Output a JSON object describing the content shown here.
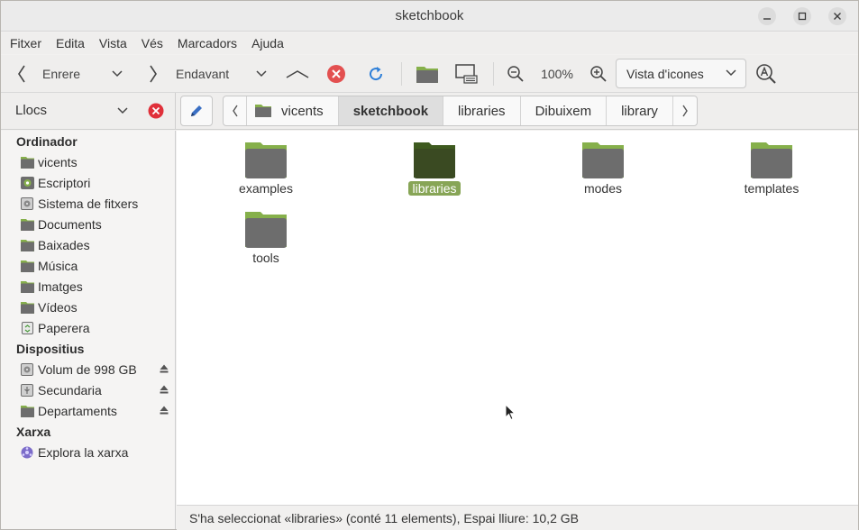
{
  "window": {
    "title": "sketchbook"
  },
  "menubar": [
    "Fitxer",
    "Edita",
    "Vista",
    "Vés",
    "Marcadors",
    "Ajuda"
  ],
  "toolbar": {
    "back_label": "Enrere",
    "forward_label": "Endavant",
    "zoom_level": "100%",
    "view_mode": "Vista d'icones"
  },
  "sidebar": {
    "header": "Llocs",
    "sections": [
      {
        "title": "Ordinador"
      },
      {
        "title": "Dispositius"
      },
      {
        "title": "Xarxa"
      }
    ],
    "items": [
      {
        "label": "vicents",
        "icon": "home-folder-icon"
      },
      {
        "label": "Escriptori",
        "icon": "desktop-icon"
      },
      {
        "label": "Sistema de fitxers",
        "icon": "drive-icon"
      },
      {
        "label": "Documents",
        "icon": "folder-icon"
      },
      {
        "label": "Baixades",
        "icon": "folder-icon"
      },
      {
        "label": "Música",
        "icon": "folder-icon"
      },
      {
        "label": "Imatges",
        "icon": "folder-icon"
      },
      {
        "label": "Vídeos",
        "icon": "folder-icon"
      },
      {
        "label": "Paperera",
        "icon": "trash-icon"
      },
      {
        "label": "Volum de 998 GB",
        "icon": "drive-icon",
        "eject": true
      },
      {
        "label": "Secundaria",
        "icon": "usb-drive-icon",
        "eject": true
      },
      {
        "label": "Departaments",
        "icon": "folder-icon",
        "eject": true
      },
      {
        "label": "Explora la xarxa",
        "icon": "network-icon"
      }
    ]
  },
  "breadcrumb": [
    "vicents",
    "sketchbook",
    "libraries",
    "Dibuixem",
    "library"
  ],
  "breadcrumb_active": "sketchbook",
  "files": [
    {
      "name": "examples",
      "selected": false
    },
    {
      "name": "libraries",
      "selected": true
    },
    {
      "name": "modes",
      "selected": false
    },
    {
      "name": "templates",
      "selected": false
    },
    {
      "name": "tools",
      "selected": false
    }
  ],
  "status": "S'ha seleccionat «libraries» (conté 11 elements), Espai lliure: 10,2 GB",
  "colors": {
    "accent": "#87a556",
    "folder_body": "#6d6d6d",
    "folder_tab": "#86b04b",
    "selected_folder": "#3a4a22"
  }
}
